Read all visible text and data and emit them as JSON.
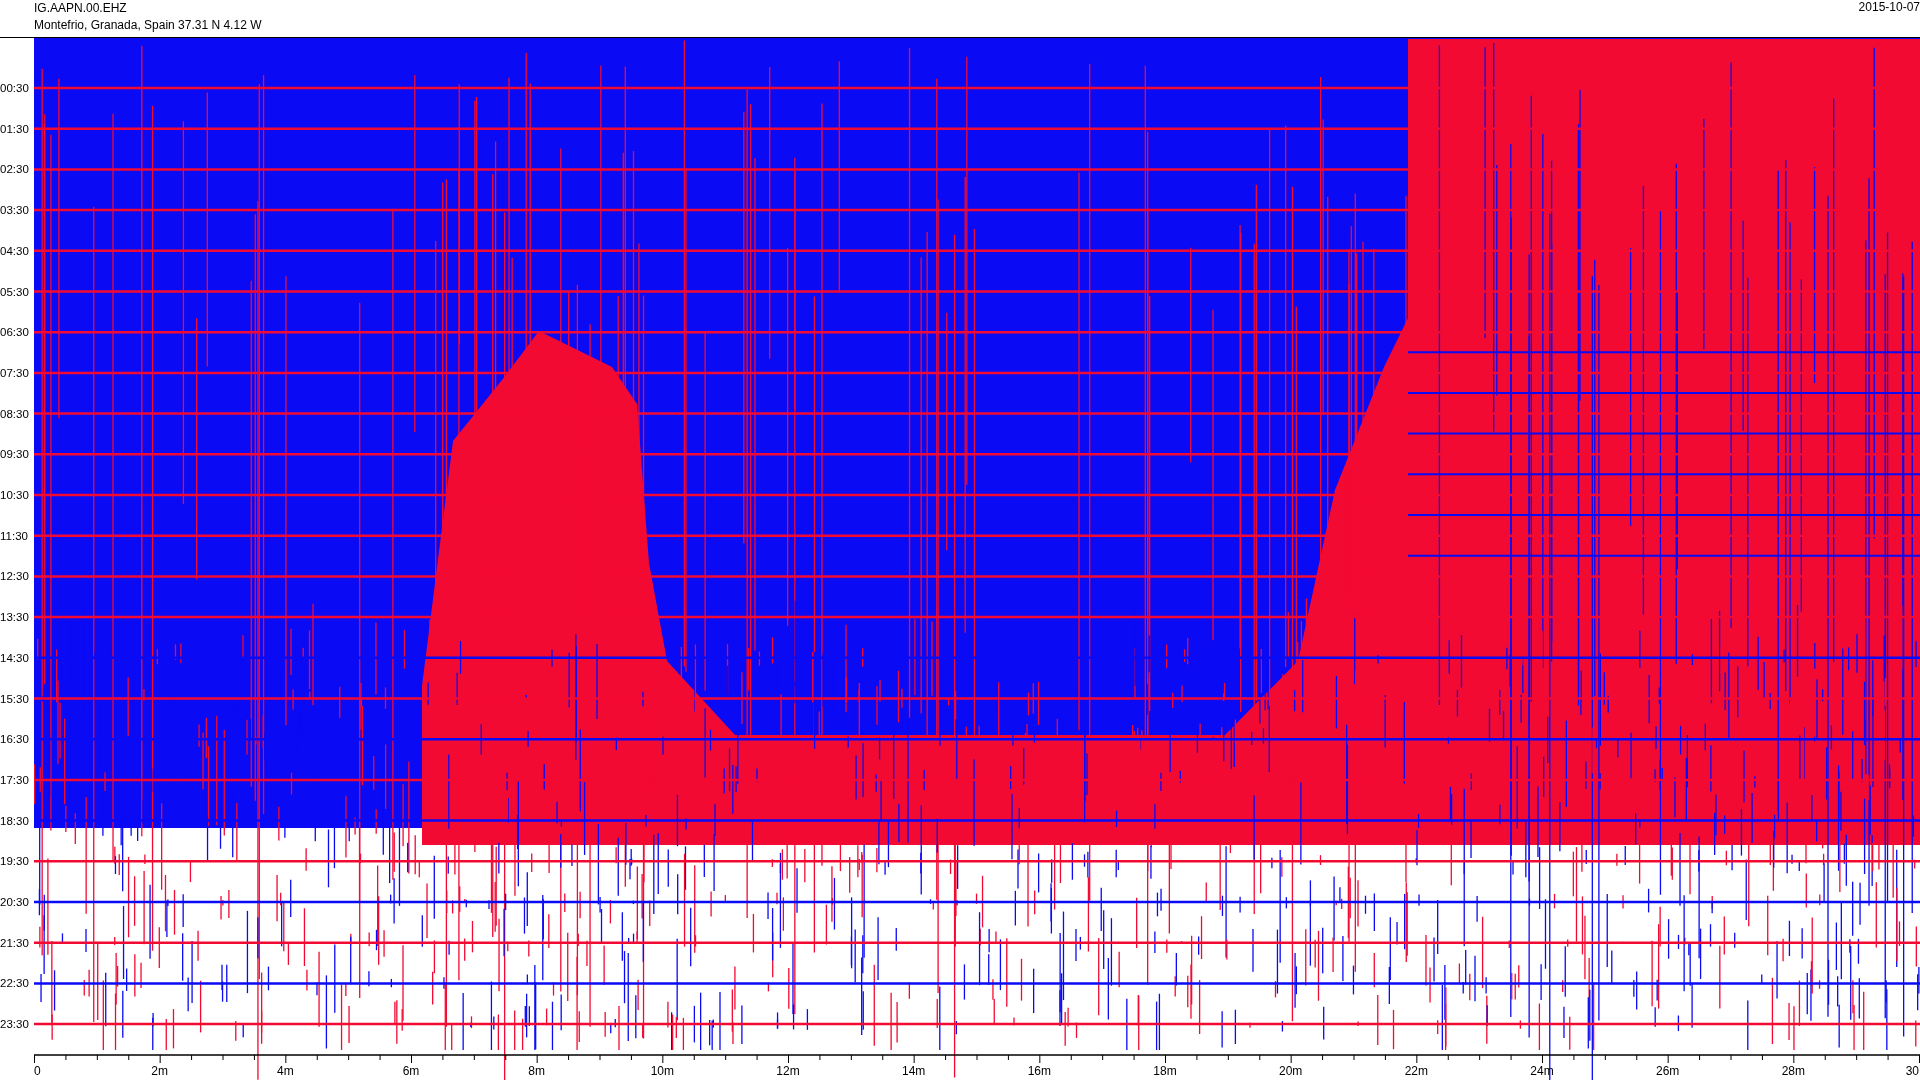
{
  "header": {
    "station": "IG.AAPN.00.EHZ",
    "location": "Montefrio, Granada, Spain  37.31 N 4.12 W",
    "date": "2015-10-07"
  },
  "y_axis": {
    "labels": [
      "00:30",
      "01:30",
      "02:30",
      "03:30",
      "04:30",
      "05:30",
      "06:30",
      "07:30",
      "08:30",
      "09:30",
      "10:30",
      "11:30",
      "12:30",
      "13:30",
      "14:30",
      "15:30",
      "16:30",
      "17:30",
      "18:30",
      "19:30",
      "20:30",
      "21:30",
      "22:30",
      "23:30"
    ]
  },
  "x_axis": {
    "labels": [
      "0",
      "2m",
      "4m",
      "6m",
      "8m",
      "10m",
      "12m",
      "14m",
      "16m",
      "18m",
      "20m",
      "22m",
      "24m",
      "26m",
      "28m",
      "30"
    ]
  }
}
